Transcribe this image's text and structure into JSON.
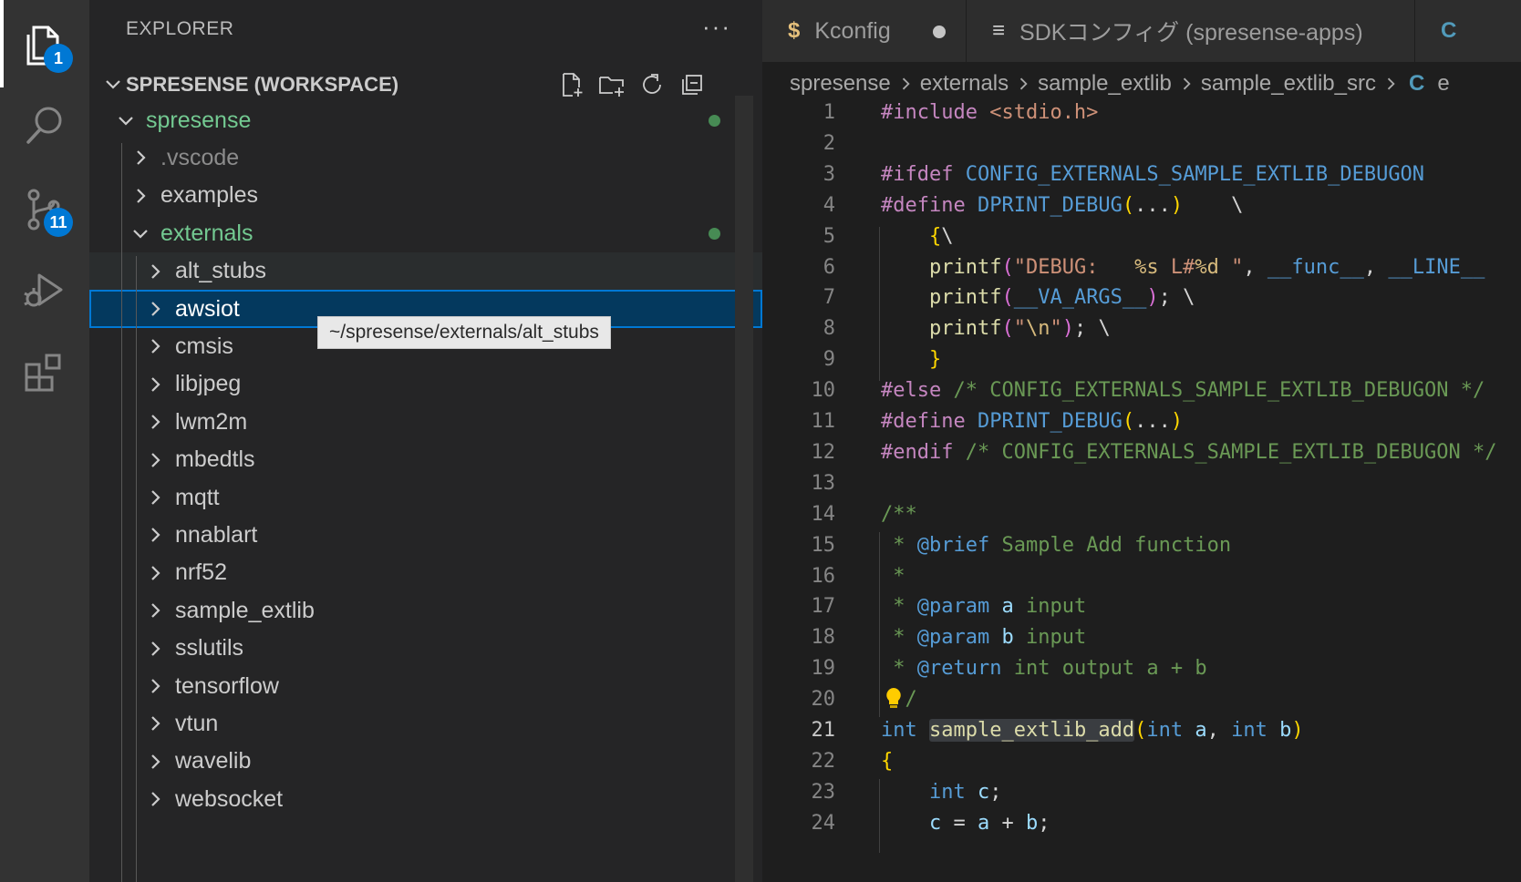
{
  "activity_bar": {
    "explorer_badge": "1",
    "scm_badge": "11"
  },
  "sidebar": {
    "title": "EXPLORER",
    "more_label": "···",
    "workspace_title": "SPRESENSE (WORKSPACE)",
    "tree": [
      {
        "label": "spresense",
        "color": "#73c991",
        "expanded": true,
        "modified": true
      },
      {
        "label": ".vscode",
        "color": "#8c8c8c",
        "expanded": false,
        "modified": false
      },
      {
        "label": "examples",
        "color": "#cccccc",
        "expanded": false,
        "modified": false
      },
      {
        "label": "externals",
        "color": "#73c991",
        "expanded": true,
        "modified": true
      },
      {
        "label": "alt_stubs",
        "color": "#cccccc",
        "expanded": false,
        "modified": false
      },
      {
        "label": "awsiot",
        "color": "#ffffff",
        "expanded": false,
        "modified": false
      },
      {
        "label": "cmsis",
        "color": "#cccccc",
        "expanded": false,
        "modified": false
      },
      {
        "label": "libjpeg",
        "color": "#cccccc",
        "expanded": false,
        "modified": false
      },
      {
        "label": "lwm2m",
        "color": "#cccccc",
        "expanded": false,
        "modified": false
      },
      {
        "label": "mbedtls",
        "color": "#cccccc",
        "expanded": false,
        "modified": false
      },
      {
        "label": "mqtt",
        "color": "#cccccc",
        "expanded": false,
        "modified": false
      },
      {
        "label": "nnablart",
        "color": "#cccccc",
        "expanded": false,
        "modified": false
      },
      {
        "label": "nrf52",
        "color": "#cccccc",
        "expanded": false,
        "modified": false
      },
      {
        "label": "sample_extlib",
        "color": "#cccccc",
        "expanded": false,
        "modified": false
      },
      {
        "label": "sslutils",
        "color": "#cccccc",
        "expanded": false,
        "modified": false
      },
      {
        "label": "tensorflow",
        "color": "#cccccc",
        "expanded": false,
        "modified": false
      },
      {
        "label": "vtun",
        "color": "#cccccc",
        "expanded": false,
        "modified": false
      },
      {
        "label": "wavelib",
        "color": "#cccccc",
        "expanded": false,
        "modified": false
      },
      {
        "label": "websocket",
        "color": "#cccccc",
        "expanded": false,
        "modified": false
      }
    ],
    "tooltip": "~/spresense/externals/alt_stubs"
  },
  "tabs": [
    {
      "icon": "$",
      "icon_color": "#e5c07b",
      "label": "Kconfig",
      "dirty": true
    },
    {
      "icon": "≡",
      "icon_color": "#cccccc",
      "label": "SDKコンフィグ (spresense-apps)",
      "dirty": false
    },
    {
      "icon": "C",
      "icon_color": "#519aba",
      "label": "",
      "dirty": false
    }
  ],
  "breadcrumb": [
    "spresense",
    "externals",
    "sample_extlib",
    "sample_extlib_src"
  ],
  "breadcrumb_file_icon": "C",
  "breadcrumb_tail": "e",
  "code": {
    "active_line": 21,
    "lines": [
      [
        [
          "pp",
          "#include"
        ],
        [
          "pl",
          " "
        ],
        [
          "inc",
          "<stdio.h>"
        ]
      ],
      [],
      [
        [
          "pp",
          "#ifdef"
        ],
        [
          "pl",
          " "
        ],
        [
          "mac",
          "CONFIG_EXTERNALS_SAMPLE_EXTLIB_DEBUGON"
        ]
      ],
      [
        [
          "pp",
          "#define"
        ],
        [
          "pl",
          " "
        ],
        [
          "mac",
          "DPRINT_DEBUG"
        ],
        [
          "br",
          "("
        ],
        [
          "pl",
          "..."
        ],
        [
          "br",
          ")"
        ],
        [
          "pl",
          "    \\"
        ]
      ],
      [
        [
          "pl",
          "    "
        ],
        [
          "br",
          "{"
        ],
        [
          "pl",
          "\\"
        ]
      ],
      [
        [
          "pl",
          "    "
        ],
        [
          "fn",
          "printf"
        ],
        [
          "br2",
          "("
        ],
        [
          "str",
          "\"DEBUG:   "
        ],
        [
          "esc",
          "%s"
        ],
        [
          "str",
          " L#"
        ],
        [
          "esc",
          "%d"
        ],
        [
          "str",
          " \""
        ],
        [
          "pl",
          ", "
        ],
        [
          "mac",
          "__func__"
        ],
        [
          "pl",
          ", "
        ],
        [
          "mac",
          "__LINE__"
        ]
      ],
      [
        [
          "pl",
          "    "
        ],
        [
          "fn",
          "printf"
        ],
        [
          "br2",
          "("
        ],
        [
          "mac",
          "__VA_ARGS__"
        ],
        [
          "br2",
          ")"
        ],
        [
          "pl",
          "; \\"
        ]
      ],
      [
        [
          "pl",
          "    "
        ],
        [
          "fn",
          "printf"
        ],
        [
          "br2",
          "("
        ],
        [
          "str",
          "\""
        ],
        [
          "esc",
          "\\n"
        ],
        [
          "str",
          "\""
        ],
        [
          "br2",
          ")"
        ],
        [
          "pl",
          "; \\"
        ]
      ],
      [
        [
          "pl",
          "    "
        ],
        [
          "br",
          "}"
        ]
      ],
      [
        [
          "pp",
          "#else"
        ],
        [
          "pl",
          " "
        ],
        [
          "com",
          "/* CONFIG_EXTERNALS_SAMPLE_EXTLIB_DEBUGON */"
        ]
      ],
      [
        [
          "pp",
          "#define"
        ],
        [
          "pl",
          " "
        ],
        [
          "mac",
          "DPRINT_DEBUG"
        ],
        [
          "br",
          "("
        ],
        [
          "pl",
          "..."
        ],
        [
          "br",
          ")"
        ]
      ],
      [
        [
          "pp",
          "#endif"
        ],
        [
          "pl",
          " "
        ],
        [
          "com",
          "/* CONFIG_EXTERNALS_SAMPLE_EXTLIB_DEBUGON */"
        ]
      ],
      [],
      [
        [
          "com",
          "/**"
        ]
      ],
      [
        [
          "com",
          " * "
        ],
        [
          "tag",
          "@brief"
        ],
        [
          "com",
          " Sample Add function"
        ]
      ],
      [
        [
          "com",
          " *"
        ]
      ],
      [
        [
          "com",
          " * "
        ],
        [
          "tag",
          "@param"
        ],
        [
          "pl",
          " "
        ],
        [
          "var",
          "a"
        ],
        [
          "com",
          " input"
        ]
      ],
      [
        [
          "com",
          " * "
        ],
        [
          "tag",
          "@param"
        ],
        [
          "pl",
          " "
        ],
        [
          "var",
          "b"
        ],
        [
          "com",
          " input"
        ]
      ],
      [
        [
          "com",
          " * "
        ],
        [
          "tag",
          "@return"
        ],
        [
          "com",
          " int output a + b"
        ]
      ],
      [
        [
          "pl",
          "  "
        ],
        [
          "com",
          "/"
        ]
      ],
      [
        [
          "kw",
          "int"
        ],
        [
          "pl",
          " "
        ],
        [
          "hl",
          "sample_extlib_add"
        ],
        [
          "br",
          "("
        ],
        [
          "kw",
          "int"
        ],
        [
          "pl",
          " "
        ],
        [
          "var",
          "a"
        ],
        [
          "pl",
          ", "
        ],
        [
          "kw",
          "int"
        ],
        [
          "pl",
          " "
        ],
        [
          "var",
          "b"
        ],
        [
          "br",
          ")"
        ]
      ],
      [
        [
          "br",
          "{"
        ]
      ],
      [
        [
          "pl",
          "    "
        ],
        [
          "kw",
          "int"
        ],
        [
          "pl",
          " "
        ],
        [
          "var",
          "c"
        ],
        [
          "pl",
          ";"
        ]
      ],
      [
        [
          "pl",
          "    "
        ],
        [
          "var",
          "c"
        ],
        [
          "pl",
          " = "
        ],
        [
          "var",
          "a"
        ],
        [
          "pl",
          " + "
        ],
        [
          "var",
          "b"
        ],
        [
          "pl",
          ";"
        ]
      ]
    ]
  }
}
